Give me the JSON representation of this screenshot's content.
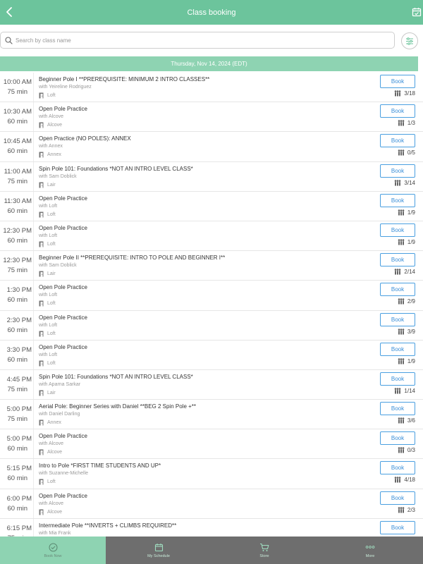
{
  "header": {
    "title": "Class booking",
    "back_icon": "chevron-left-icon",
    "calendar_icon": "calendar-check-icon"
  },
  "search": {
    "placeholder": "Search by class name",
    "value": ""
  },
  "date_label": "Thursday, Nov 14, 2024 (EDT)",
  "book_label": "Book",
  "classes": [
    {
      "time": "10:00 AM",
      "duration": "75 min",
      "name": "Beginner Pole I **PREREQUISITE: MINIMUM 2 INTRO CLASSES**",
      "teacher": "with Yeireline Rodriguez",
      "room": "Loft",
      "spots": "3/18"
    },
    {
      "time": "10:30 AM",
      "duration": "60 min",
      "name": "Open Pole Practice",
      "teacher": "with Alcove",
      "room": "Alcove",
      "spots": "1/3"
    },
    {
      "time": "10:45 AM",
      "duration": "60 min",
      "name": "Open Practice (NO POLES): ANNEX",
      "teacher": "with Annex",
      "room": "Annex",
      "spots": "0/5"
    },
    {
      "time": "11:00 AM",
      "duration": "75 min",
      "name": "Spin Pole 101: Foundations *NOT AN INTRO LEVEL CLASS*",
      "teacher": "with Sam Doblick",
      "room": "Lair",
      "spots": "3/14"
    },
    {
      "time": "11:30 AM",
      "duration": "60 min",
      "name": "Open Pole Practice",
      "teacher": "with Loft",
      "room": "Loft",
      "spots": "1/9"
    },
    {
      "time": "12:30 PM",
      "duration": "60 min",
      "name": "Open Pole Practice",
      "teacher": "with Loft",
      "room": "Loft",
      "spots": "1/9"
    },
    {
      "time": "12:30 PM",
      "duration": "75 min",
      "name": "Beginner Pole II **PREREQUISITE: INTRO TO POLE AND BEGINNER I**",
      "teacher": "with Sam Doblick",
      "room": "Lair",
      "spots": "2/14"
    },
    {
      "time": "1:30 PM",
      "duration": "60 min",
      "name": "Open Pole Practice",
      "teacher": "with Loft",
      "room": "Loft",
      "spots": "2/9"
    },
    {
      "time": "2:30 PM",
      "duration": "60 min",
      "name": "Open Pole Practice",
      "teacher": "with Loft",
      "room": "Loft",
      "spots": "3/9"
    },
    {
      "time": "3:30 PM",
      "duration": "60 min",
      "name": "Open Pole Practice",
      "teacher": "with Loft",
      "room": "Loft",
      "spots": "1/9"
    },
    {
      "time": "4:45 PM",
      "duration": "75 min",
      "name": "Spin Pole 101: Foundations *NOT AN INTRO LEVEL CLASS*",
      "teacher": "with Aparna Sarkar",
      "room": "Lair",
      "spots": "1/14"
    },
    {
      "time": "5:00 PM",
      "duration": "75 min",
      "name": "Aerial Pole: Beginner Series with Daniel **BEG 2 Spin Pole +**",
      "teacher": "with Daniel Darling",
      "room": "Annex",
      "spots": "3/6"
    },
    {
      "time": "5:00 PM",
      "duration": "60 min",
      "name": "Open Pole Practice",
      "teacher": "with Alcove",
      "room": "Alcove",
      "spots": "0/3"
    },
    {
      "time": "5:15 PM",
      "duration": "60 min",
      "name": "Intro to Pole *FIRST TIME STUDENTS AND UP*",
      "teacher": "with Suzanne-Michelle",
      "room": "Loft",
      "spots": "4/18"
    },
    {
      "time": "6:00 PM",
      "duration": "60 min",
      "name": "Open Pole Practice",
      "teacher": "with Alcove",
      "room": "Alcove",
      "spots": "2/3"
    },
    {
      "time": "6:15 PM",
      "duration": "75 min",
      "name": "Intermediate Pole **INVERTS + CLIMBS REQUIRED**",
      "teacher": "with Mia Frank",
      "room": "",
      "spots": ""
    }
  ],
  "tabs": [
    {
      "label": "Book Now",
      "icon": "check-circle-icon",
      "active": true
    },
    {
      "label": "My Schedule",
      "icon": "calendar-icon",
      "active": false
    },
    {
      "label": "Store",
      "icon": "cart-icon",
      "active": false
    },
    {
      "label": "More",
      "icon": "more-dots-icon",
      "active": false
    }
  ],
  "colors": {
    "brand": "#6cc49c",
    "date_band": "#8ed3b2",
    "book_button": "#4a9fe0",
    "tab_inactive": "#6e6e6e"
  }
}
